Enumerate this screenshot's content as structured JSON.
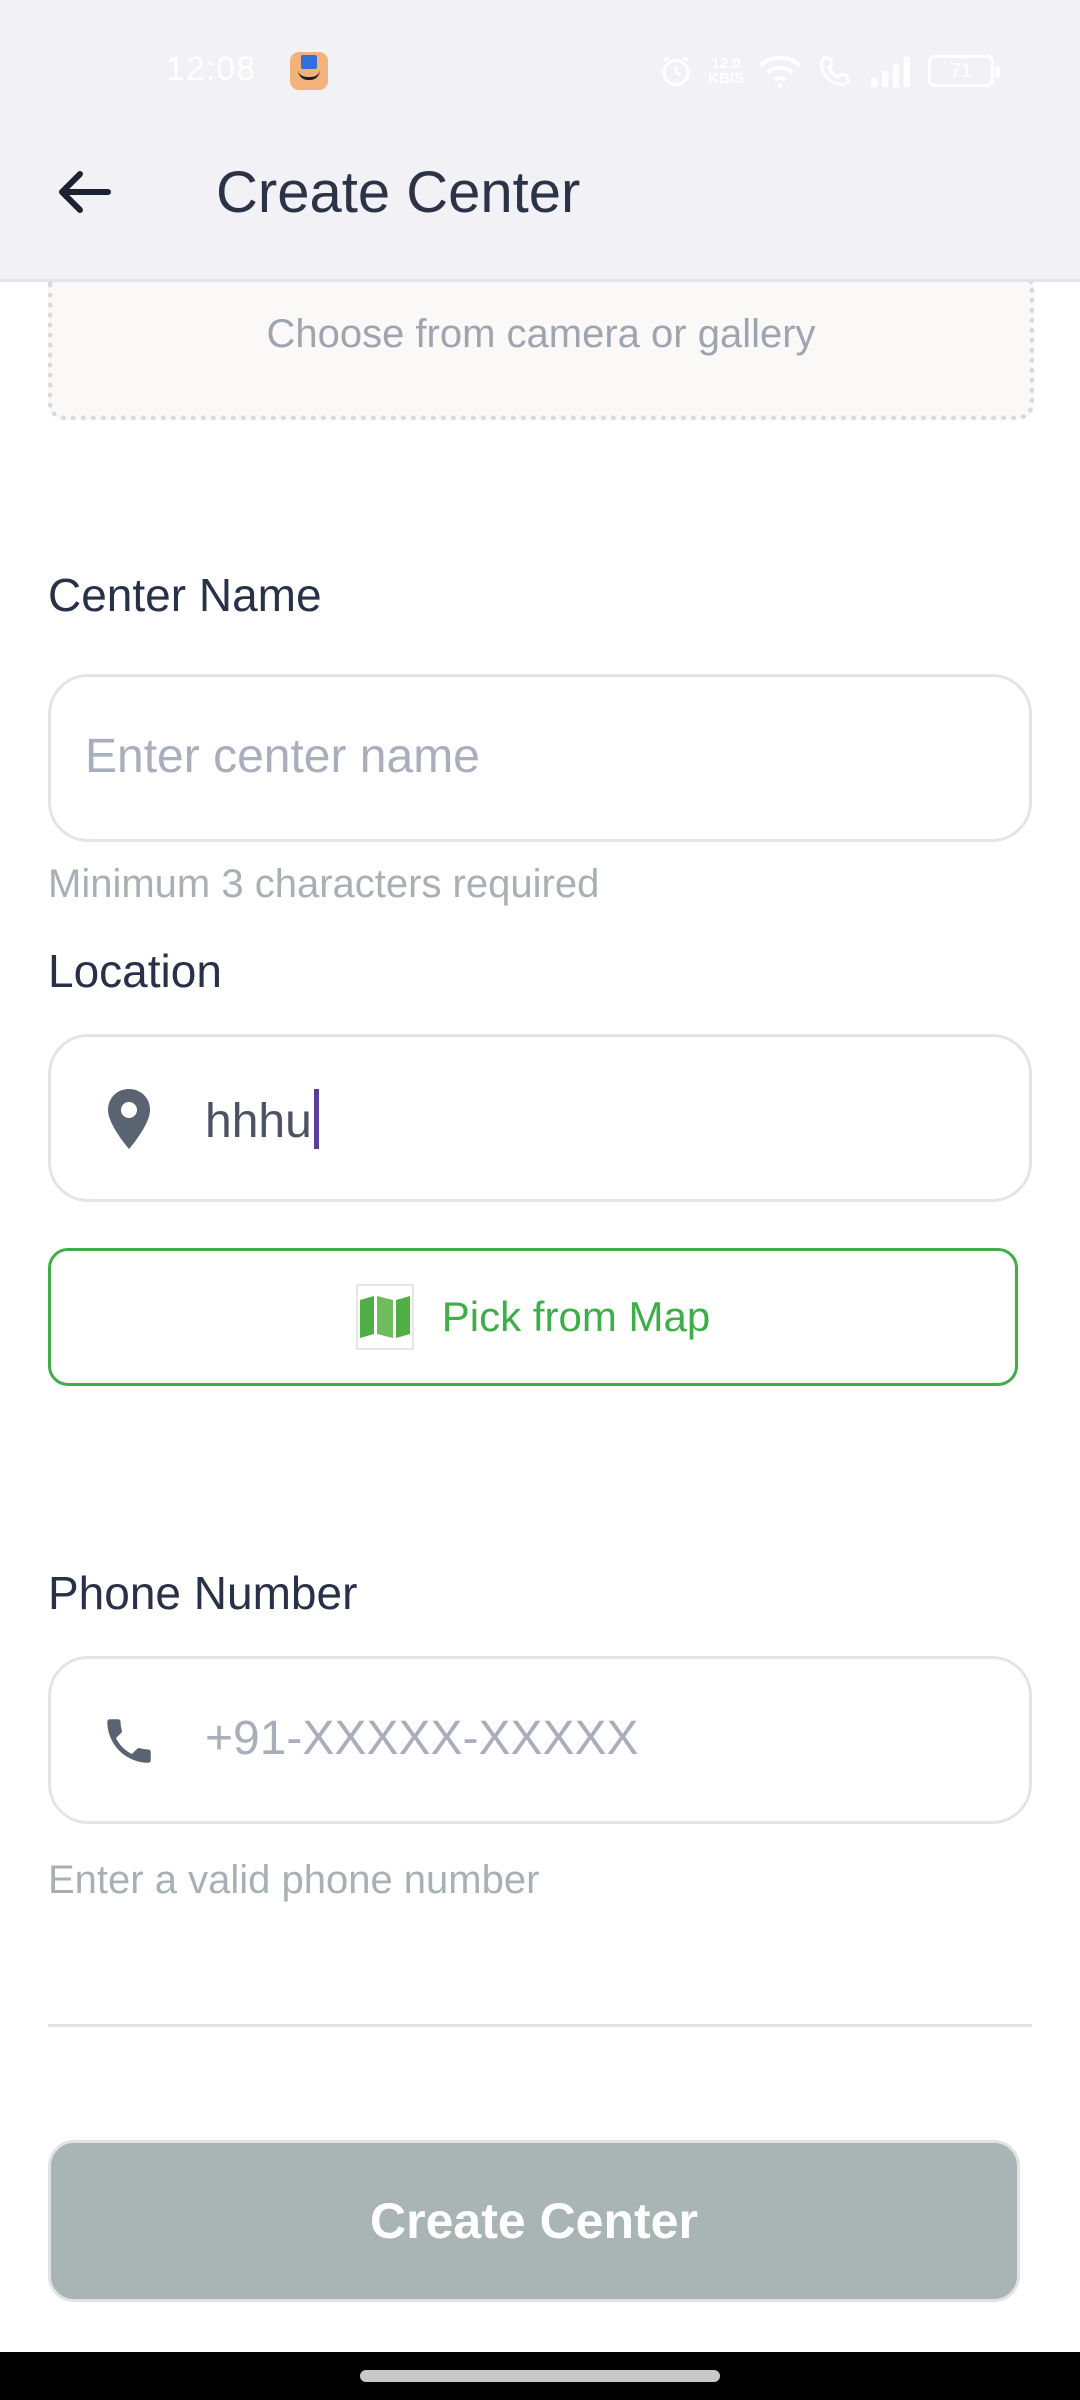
{
  "status_bar": {
    "time": "12:08",
    "net_speed_value": "12.0",
    "net_speed_unit": "KB/S",
    "battery": "71"
  },
  "app_bar": {
    "title": "Create Center"
  },
  "upload": {
    "text": "Choose from camera or gallery"
  },
  "form": {
    "center_name": {
      "label": "Center Name",
      "placeholder": "Enter center name",
      "helper": "Minimum 3 characters required"
    },
    "location": {
      "label": "Location",
      "value": "hhhu",
      "map_button_label": "Pick from Map"
    },
    "phone": {
      "label": "Phone Number",
      "placeholder": "+91-XXXXX-XXXXX",
      "helper": "Enter a valid phone number"
    }
  },
  "submit": {
    "label": "Create Center"
  },
  "colors": {
    "accent_green": "#3fae47",
    "disabled_button": "#a9b4b5",
    "caret": "#5b3d99"
  },
  "icons": {
    "back": "arrow-left-icon",
    "location": "map-pin-icon",
    "map": "folded-map-icon",
    "phone": "phone-icon"
  }
}
